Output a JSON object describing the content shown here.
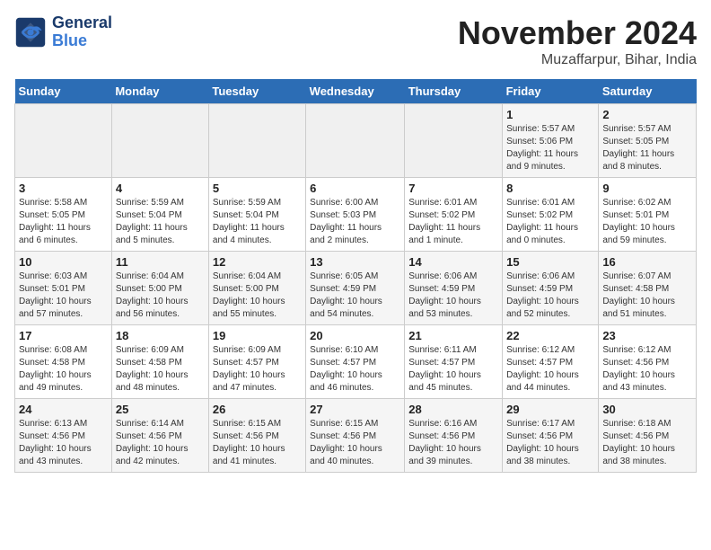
{
  "header": {
    "logo_line1": "General",
    "logo_line2": "Blue",
    "month": "November 2024",
    "location": "Muzaffarpur, Bihar, India"
  },
  "weekdays": [
    "Sunday",
    "Monday",
    "Tuesday",
    "Wednesday",
    "Thursday",
    "Friday",
    "Saturday"
  ],
  "weeks": [
    [
      {
        "day": "",
        "info": ""
      },
      {
        "day": "",
        "info": ""
      },
      {
        "day": "",
        "info": ""
      },
      {
        "day": "",
        "info": ""
      },
      {
        "day": "",
        "info": ""
      },
      {
        "day": "1",
        "info": "Sunrise: 5:57 AM\nSunset: 5:06 PM\nDaylight: 11 hours\nand 9 minutes."
      },
      {
        "day": "2",
        "info": "Sunrise: 5:57 AM\nSunset: 5:05 PM\nDaylight: 11 hours\nand 8 minutes."
      }
    ],
    [
      {
        "day": "3",
        "info": "Sunrise: 5:58 AM\nSunset: 5:05 PM\nDaylight: 11 hours\nand 6 minutes."
      },
      {
        "day": "4",
        "info": "Sunrise: 5:59 AM\nSunset: 5:04 PM\nDaylight: 11 hours\nand 5 minutes."
      },
      {
        "day": "5",
        "info": "Sunrise: 5:59 AM\nSunset: 5:04 PM\nDaylight: 11 hours\nand 4 minutes."
      },
      {
        "day": "6",
        "info": "Sunrise: 6:00 AM\nSunset: 5:03 PM\nDaylight: 11 hours\nand 2 minutes."
      },
      {
        "day": "7",
        "info": "Sunrise: 6:01 AM\nSunset: 5:02 PM\nDaylight: 11 hours\nand 1 minute."
      },
      {
        "day": "8",
        "info": "Sunrise: 6:01 AM\nSunset: 5:02 PM\nDaylight: 11 hours\nand 0 minutes."
      },
      {
        "day": "9",
        "info": "Sunrise: 6:02 AM\nSunset: 5:01 PM\nDaylight: 10 hours\nand 59 minutes."
      }
    ],
    [
      {
        "day": "10",
        "info": "Sunrise: 6:03 AM\nSunset: 5:01 PM\nDaylight: 10 hours\nand 57 minutes."
      },
      {
        "day": "11",
        "info": "Sunrise: 6:04 AM\nSunset: 5:00 PM\nDaylight: 10 hours\nand 56 minutes."
      },
      {
        "day": "12",
        "info": "Sunrise: 6:04 AM\nSunset: 5:00 PM\nDaylight: 10 hours\nand 55 minutes."
      },
      {
        "day": "13",
        "info": "Sunrise: 6:05 AM\nSunset: 4:59 PM\nDaylight: 10 hours\nand 54 minutes."
      },
      {
        "day": "14",
        "info": "Sunrise: 6:06 AM\nSunset: 4:59 PM\nDaylight: 10 hours\nand 53 minutes."
      },
      {
        "day": "15",
        "info": "Sunrise: 6:06 AM\nSunset: 4:59 PM\nDaylight: 10 hours\nand 52 minutes."
      },
      {
        "day": "16",
        "info": "Sunrise: 6:07 AM\nSunset: 4:58 PM\nDaylight: 10 hours\nand 51 minutes."
      }
    ],
    [
      {
        "day": "17",
        "info": "Sunrise: 6:08 AM\nSunset: 4:58 PM\nDaylight: 10 hours\nand 49 minutes."
      },
      {
        "day": "18",
        "info": "Sunrise: 6:09 AM\nSunset: 4:58 PM\nDaylight: 10 hours\nand 48 minutes."
      },
      {
        "day": "19",
        "info": "Sunrise: 6:09 AM\nSunset: 4:57 PM\nDaylight: 10 hours\nand 47 minutes."
      },
      {
        "day": "20",
        "info": "Sunrise: 6:10 AM\nSunset: 4:57 PM\nDaylight: 10 hours\nand 46 minutes."
      },
      {
        "day": "21",
        "info": "Sunrise: 6:11 AM\nSunset: 4:57 PM\nDaylight: 10 hours\nand 45 minutes."
      },
      {
        "day": "22",
        "info": "Sunrise: 6:12 AM\nSunset: 4:57 PM\nDaylight: 10 hours\nand 44 minutes."
      },
      {
        "day": "23",
        "info": "Sunrise: 6:12 AM\nSunset: 4:56 PM\nDaylight: 10 hours\nand 43 minutes."
      }
    ],
    [
      {
        "day": "24",
        "info": "Sunrise: 6:13 AM\nSunset: 4:56 PM\nDaylight: 10 hours\nand 43 minutes."
      },
      {
        "day": "25",
        "info": "Sunrise: 6:14 AM\nSunset: 4:56 PM\nDaylight: 10 hours\nand 42 minutes."
      },
      {
        "day": "26",
        "info": "Sunrise: 6:15 AM\nSunset: 4:56 PM\nDaylight: 10 hours\nand 41 minutes."
      },
      {
        "day": "27",
        "info": "Sunrise: 6:15 AM\nSunset: 4:56 PM\nDaylight: 10 hours\nand 40 minutes."
      },
      {
        "day": "28",
        "info": "Sunrise: 6:16 AM\nSunset: 4:56 PM\nDaylight: 10 hours\nand 39 minutes."
      },
      {
        "day": "29",
        "info": "Sunrise: 6:17 AM\nSunset: 4:56 PM\nDaylight: 10 hours\nand 38 minutes."
      },
      {
        "day": "30",
        "info": "Sunrise: 6:18 AM\nSunset: 4:56 PM\nDaylight: 10 hours\nand 38 minutes."
      }
    ]
  ]
}
